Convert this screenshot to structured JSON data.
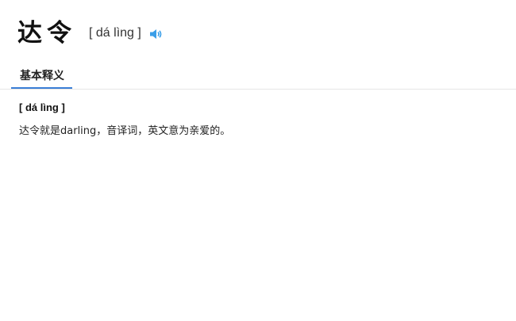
{
  "entry": {
    "word": "达令",
    "pinyin": "[ dá lìng ]",
    "speaker_icon": "speaker-icon",
    "accent_color": "#3a9ee8"
  },
  "tabs": [
    {
      "label": "基本释义",
      "active": true
    }
  ],
  "definition": {
    "pinyin": "[ dá lìng ]",
    "text": "达令就是darling，音译词，英文意为亲爱的。"
  },
  "colors": {
    "tab_underline": "#3a7ed6",
    "divider": "#e6e6e6"
  }
}
